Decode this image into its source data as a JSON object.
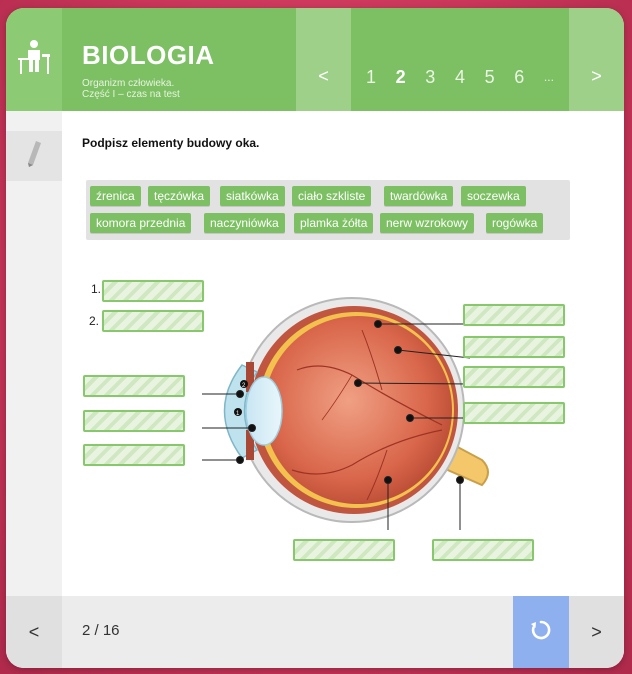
{
  "header": {
    "title": "BIOLOGIA",
    "subtitle_line1": "Organizm człowieka.",
    "subtitle_line2": "Część I – czas na test",
    "prev_arrow": "<",
    "next_arrow": ">",
    "pages": [
      "1",
      "2",
      "3",
      "4",
      "5",
      "6",
      "..."
    ],
    "active_page": "2"
  },
  "question": "Podpisz elementy budowy oka.",
  "word_bank": [
    "źrenica",
    "tęczówka",
    "siatkówka",
    "ciało szkliste",
    "twardówka",
    "soczewka",
    "komora przednia",
    "naczyniówka",
    "plamka żółta",
    "nerw wzrokowy",
    "rogówka"
  ],
  "slot_labels": {
    "first": "1.",
    "second": "2."
  },
  "footer": {
    "prev_arrow": "<",
    "next_arrow": ">",
    "counter": "2 / 16"
  },
  "colors": {
    "accent_green": "#7dc064",
    "reset_blue": "#8fb0ee",
    "background": "#c9365a"
  },
  "icons": [
    "student-at-desk-icon",
    "pencil-icon",
    "reset-icon"
  ]
}
